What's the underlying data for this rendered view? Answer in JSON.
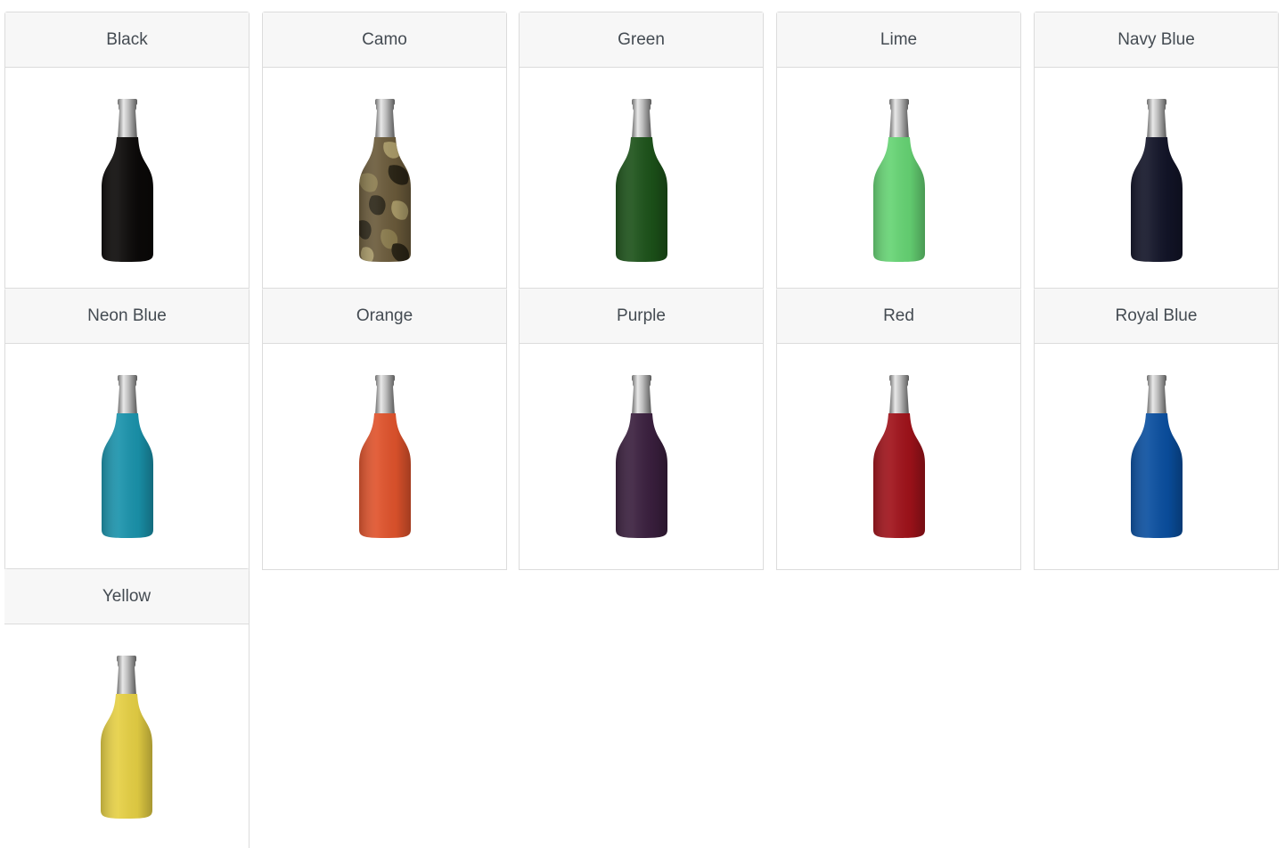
{
  "colors": [
    {
      "label": "Black",
      "fill": "#0b0908",
      "pattern": "solid"
    },
    {
      "label": "Camo",
      "fill": "#6a5a3a",
      "pattern": "camo"
    },
    {
      "label": "Green",
      "fill": "#1c5219",
      "pattern": "solid"
    },
    {
      "label": "Lime",
      "fill": "#66d474",
      "pattern": "solid"
    },
    {
      "label": "Navy Blue",
      "fill": "#121428",
      "pattern": "solid"
    },
    {
      "label": "Neon Blue",
      "fill": "#1a93ac",
      "pattern": "solid"
    },
    {
      "label": "Orange",
      "fill": "#e0532c",
      "pattern": "solid"
    },
    {
      "label": "Purple",
      "fill": "#3a1f3e",
      "pattern": "solid"
    },
    {
      "label": "Red",
      "fill": "#a0121a",
      "pattern": "solid"
    },
    {
      "label": "Royal Blue",
      "fill": "#0a4fa0",
      "pattern": "solid"
    },
    {
      "label": "Yellow",
      "fill": "#e6d044",
      "pattern": "solid"
    }
  ]
}
